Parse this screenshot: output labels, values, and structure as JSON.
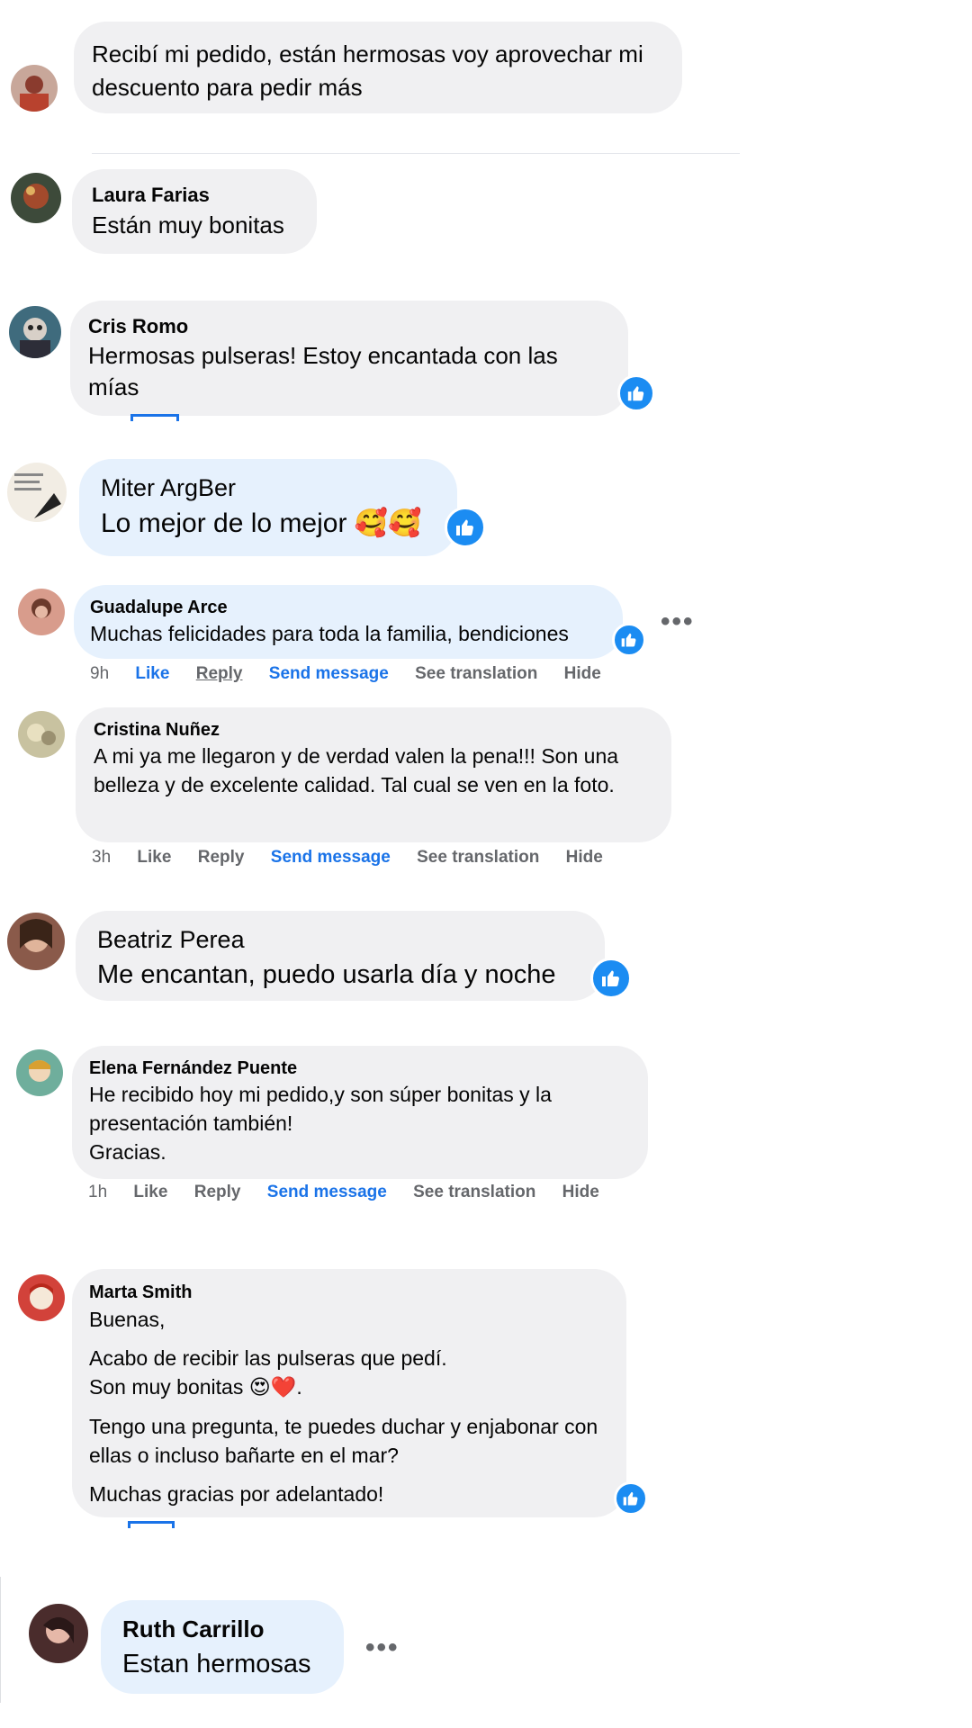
{
  "comments": [
    {
      "id": "c1",
      "name": "",
      "text": "Recibí mi pedido, están hermosas voy aprovechar mi descuento para pedir más"
    },
    {
      "id": "c2",
      "name": "Laura Farias",
      "text": "Están muy bonitas"
    },
    {
      "id": "c3",
      "name": "Cris Romo",
      "text": "Hermosas pulseras! Estoy encantada con las mías"
    },
    {
      "id": "c4",
      "name": "Miter ArgBer",
      "text": "Lo mejor de lo mejor",
      "emoji": "🥰🥰"
    },
    {
      "id": "c5",
      "name": "Guadalupe Arce",
      "text": "Muchas felicidades para toda la familia, bendiciones",
      "actions": {
        "time": "9h",
        "like": "Like",
        "reply": "Reply",
        "send": "Send message",
        "translate": "See translation",
        "hide": "Hide"
      }
    },
    {
      "id": "c6",
      "name": "Cristina Nuñez",
      "text": "A mi ya me llegaron y de verdad valen la pena!!! Son una belleza y de excelente calidad. Tal cual se ven en la foto.",
      "actions": {
        "time": "3h",
        "like": "Like",
        "reply": "Reply",
        "send": "Send message",
        "translate": "See translation",
        "hide": "Hide"
      }
    },
    {
      "id": "c7",
      "name": "Beatriz Perea",
      "text": "Me encantan, puedo usarla día y noche"
    },
    {
      "id": "c8",
      "name": "Elena Fernández Puente",
      "text1": "He recibido hoy mi pedido,y son súper bonitas y la presentación también!",
      "text2": "Gracias.",
      "actions": {
        "time": "1h",
        "like": "Like",
        "reply": "Reply",
        "send": "Send message",
        "translate": "See translation",
        "hide": "Hide"
      }
    },
    {
      "id": "c9",
      "name": "Marta Smith",
      "p1": "Buenas,",
      "p2a": "Acabo de recibir las pulseras que pedí.",
      "p2b": "Son muy bonitas",
      "p2emoji": "😍❤️",
      "p3": "Tengo una pregunta, te puedes duchar y enjabonar con ellas o incluso bañarte en el mar?",
      "p4": "Muchas gracias por adelantado!"
    },
    {
      "id": "c10",
      "name": "Ruth Carrillo",
      "text": "Estan hermosas"
    }
  ],
  "colors": {
    "bubble_gray": "#f0f0f2",
    "bubble_blue": "#e6f1fd",
    "like_blue": "#1b8cf2",
    "link_blue": "#1a73e8",
    "meta_gray": "#65676b"
  }
}
